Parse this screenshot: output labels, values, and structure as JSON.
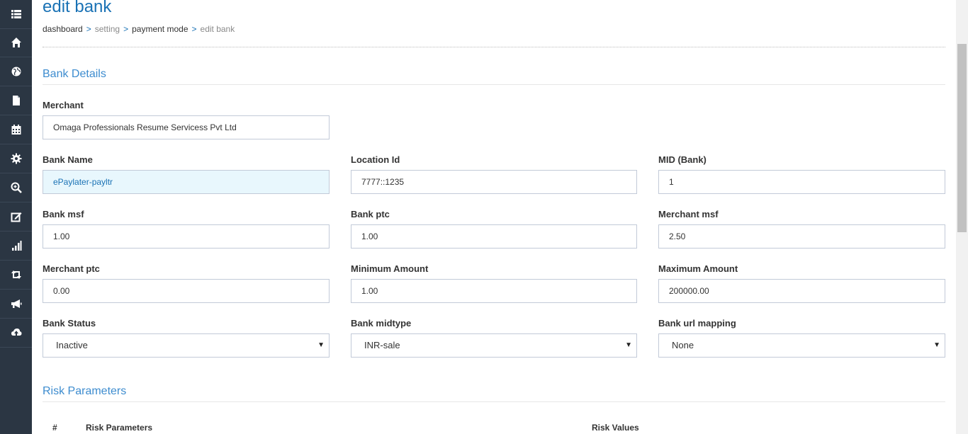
{
  "page": {
    "title": "edit bank"
  },
  "breadcrumb": {
    "items": [
      "dashboard",
      "setting",
      "payment mode",
      "edit bank"
    ],
    "separator": ">"
  },
  "sidebar": {
    "icons": [
      "list-icon",
      "home-icon",
      "globe-icon",
      "document-icon",
      "calendar-icon",
      "gear-icon",
      "search-zoom-icon",
      "edit-icon",
      "bar-chart-icon",
      "retweet-icon",
      "bullhorn-icon",
      "cloud-upload-icon"
    ]
  },
  "bank_details": {
    "section_title": "Bank Details",
    "merchant": {
      "label": "Merchant",
      "value": "Omaga Professionals Resume Servicess Pvt Ltd"
    },
    "bank_name": {
      "label": "Bank Name",
      "value": "ePaylater-payltr"
    },
    "location_id": {
      "label": "Location Id",
      "value": "7777::1235"
    },
    "mid_bank": {
      "label": "MID (Bank)",
      "value": "1"
    },
    "bank_msf": {
      "label": "Bank msf",
      "value": "1.00"
    },
    "bank_ptc": {
      "label": "Bank ptc",
      "value": "1.00"
    },
    "merchant_msf": {
      "label": "Merchant msf",
      "value": "2.50"
    },
    "merchant_ptc": {
      "label": "Merchant ptc",
      "value": "0.00"
    },
    "minimum_amount": {
      "label": "Minimum Amount",
      "value": "1.00"
    },
    "maximum_amount": {
      "label": "Maximum Amount",
      "value": "200000.00"
    },
    "bank_status": {
      "label": "Bank Status",
      "selected": "Inactive"
    },
    "bank_midtype": {
      "label": "Bank midtype",
      "selected": "INR-sale"
    },
    "bank_url_mapping": {
      "label": "Bank url mapping",
      "selected": "None"
    }
  },
  "risk_parameters": {
    "section_title": "Risk Parameters",
    "columns": [
      "#",
      "Risk Parameters",
      "Risk Values"
    ]
  },
  "colors": {
    "sidebar_bg": "#2b3643",
    "accent": "#1a72b5",
    "highlight_field_bg": "#e8f7fd"
  }
}
